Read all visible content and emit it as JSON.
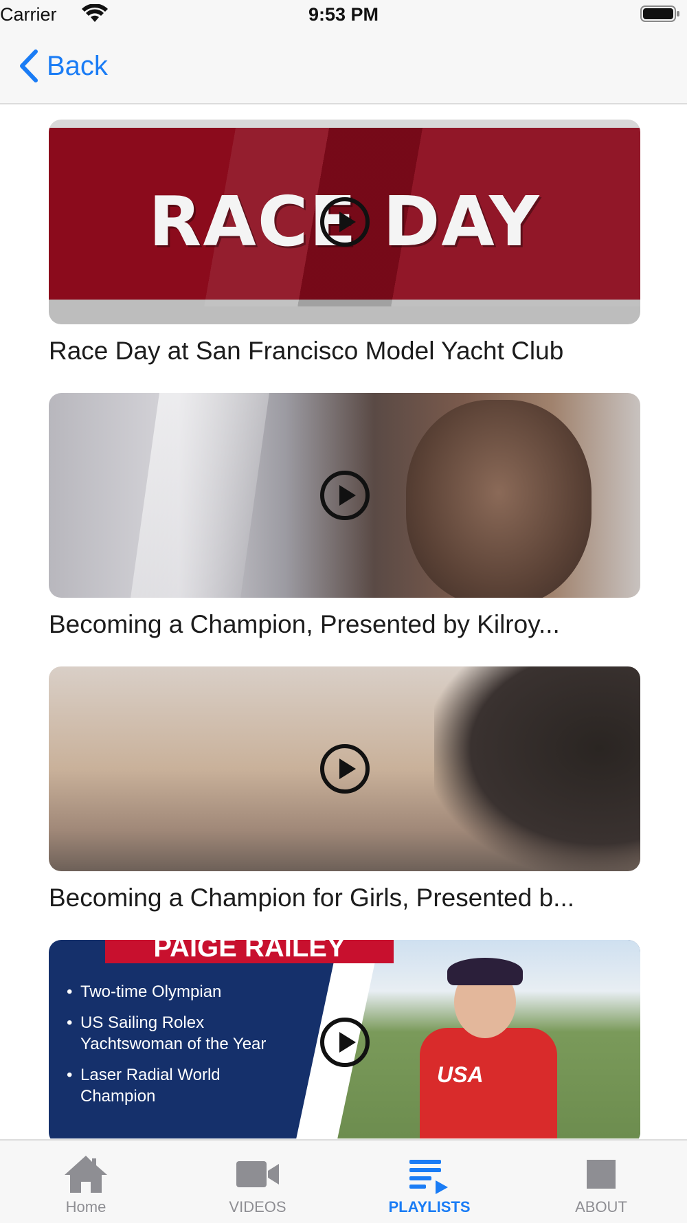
{
  "status_bar": {
    "carrier": "Carrier",
    "time": "9:53 PM"
  },
  "nav": {
    "back_label": "Back"
  },
  "videos": [
    {
      "title": "Race Day at San Francisco Model Yacht Club",
      "thumb_text": "RACE DAY"
    },
    {
      "title": "Becoming a Champion, Presented by Kilroy..."
    },
    {
      "title": "Becoming a Champion for Girls, Presented b..."
    },
    {
      "title": "",
      "thumb_banner": "PAIGE RAILEY",
      "thumb_bullets": [
        "Two-time Olympian",
        "US Sailing Rolex Yachtswoman of the Year",
        "Laser Radial World Champion"
      ],
      "thumb_shirt": "USA"
    }
  ],
  "tabs": [
    {
      "label": "Home",
      "icon": "home-icon"
    },
    {
      "label": "VIDEOS",
      "icon": "video-camera-icon"
    },
    {
      "label": "PLAYLISTS",
      "icon": "playlist-icon",
      "active": true
    },
    {
      "label": "ABOUT",
      "icon": "square-icon"
    }
  ],
  "colors": {
    "accent": "#1a7cf5",
    "tab_inactive": "#8e8e93"
  }
}
